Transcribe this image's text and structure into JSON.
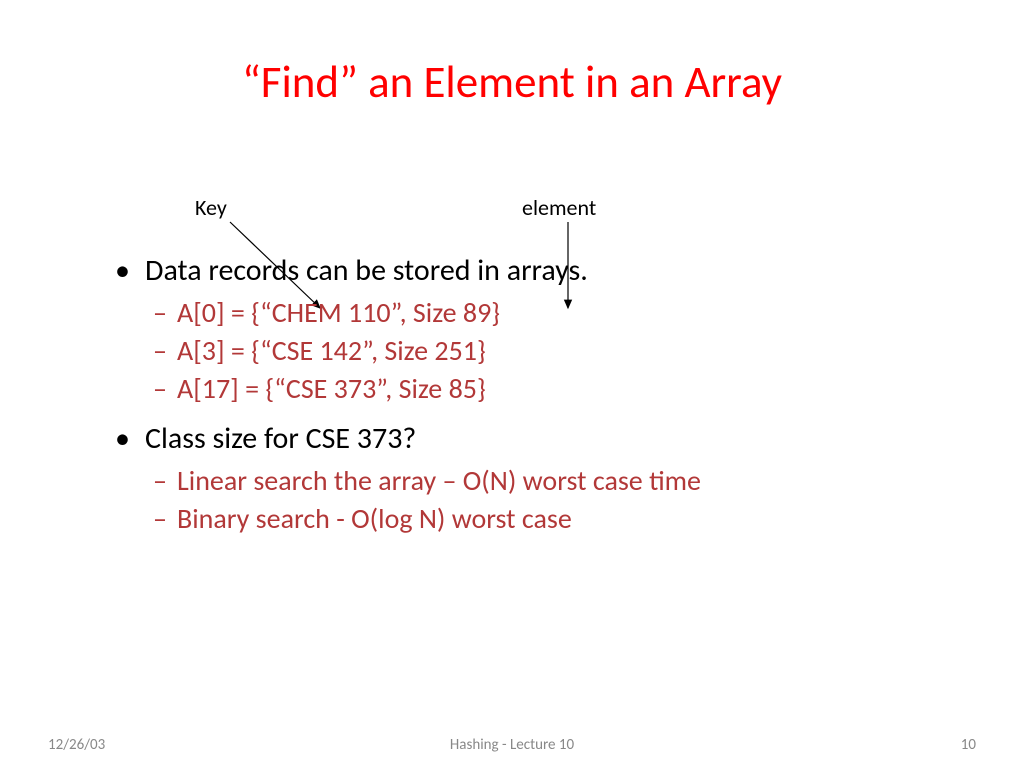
{
  "title": "“Find”  an Element in an Array",
  "annotations": {
    "key": "Key",
    "element": "element"
  },
  "bullets": {
    "main1": "Data records can be stored in arrays.",
    "sub1a": "A[0] = {“CHEM 110”, Size 89}",
    "sub1b": "A[3] = {“CSE 142”, Size 251}",
    "sub1c": "A[17] = {“CSE 373”, Size 85}",
    "main2": "Class size for CSE 373?",
    "sub2a": "Linear search the array – O(N) worst case time",
    "sub2b": "Binary search - O(log N) worst case"
  },
  "footer": {
    "date": "12/26/03",
    "center": "Hashing - Lecture 10",
    "page": "10"
  }
}
